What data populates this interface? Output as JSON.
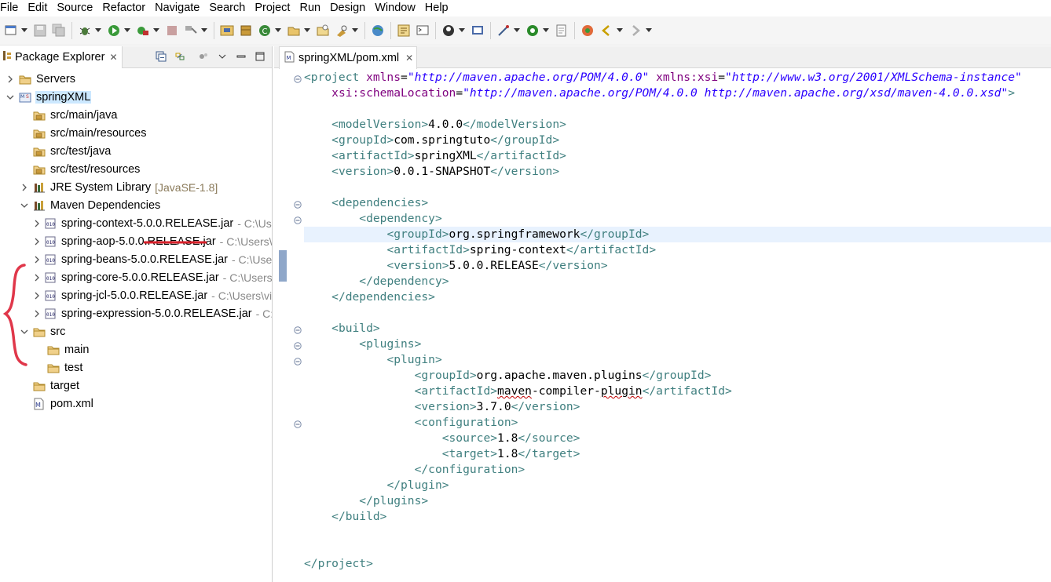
{
  "menu": [
    "File",
    "Edit",
    "Source",
    "Refactor",
    "Navigate",
    "Search",
    "Project",
    "Run",
    "Design",
    "Window",
    "Help"
  ],
  "toolbar": {
    "icons": [
      "new-icon",
      "save-icon",
      "save-all-icon",
      "debug-icon",
      "run-icon",
      "coverage-icon",
      "stop-icon",
      "external-tools-icon",
      "new-java-project-icon",
      "new-package-icon",
      "new-class-icon",
      "open-type-icon",
      "open-task-icon",
      "search-icon",
      "browser-icon",
      "open-perspective-icon",
      "console-icon",
      "pin-icon",
      "spring-icon",
      "annotation-icon",
      "next-annotation-icon",
      "prev-annotation-icon",
      "last-edit-icon",
      "back-icon",
      "forward-icon"
    ]
  },
  "package_explorer": {
    "tab_label": "Package Explorer",
    "tree": [
      {
        "label": "Servers",
        "icon": "folder-icon",
        "indent": 0,
        "expanded": false
      },
      {
        "label": "springXML",
        "icon": "maven-project-icon",
        "indent": 0,
        "expanded": true,
        "selected": true
      },
      {
        "label": "src/main/java",
        "icon": "source-folder-icon",
        "indent": 1
      },
      {
        "label": "src/main/resources",
        "icon": "source-folder-icon",
        "indent": 1
      },
      {
        "label": "src/test/java",
        "icon": "source-folder-icon",
        "indent": 1
      },
      {
        "label": "src/test/resources",
        "icon": "source-folder-icon",
        "indent": 1
      },
      {
        "label": "JRE System Library",
        "decoration": "[JavaSE-1.8]",
        "icon": "library-icon",
        "indent": 1,
        "expanded": false
      },
      {
        "label": "Maven Dependencies",
        "icon": "library-icon",
        "indent": 1,
        "expanded": true
      },
      {
        "label": "spring-context-5.0.0.RELEASE.jar",
        "path": "- C:\\Use",
        "icon": "jar-icon",
        "indent": 2,
        "expanded": false
      },
      {
        "label": "spring-aop-5.0.0.RELEASE.jar",
        "path": "- C:\\Users\\v",
        "icon": "jar-icon",
        "indent": 2,
        "expanded": false
      },
      {
        "label": "spring-beans-5.0.0.RELEASE.jar",
        "path": "- C:\\Users",
        "icon": "jar-icon",
        "indent": 2,
        "expanded": false
      },
      {
        "label": "spring-core-5.0.0.RELEASE.jar",
        "path": "- C:\\Users\\'",
        "icon": "jar-icon",
        "indent": 2,
        "expanded": false
      },
      {
        "label": "spring-jcl-5.0.0.RELEASE.jar",
        "path": "- C:\\Users\\vir",
        "icon": "jar-icon",
        "indent": 2,
        "expanded": false
      },
      {
        "label": "spring-expression-5.0.0.RELEASE.jar",
        "path": "- C:\\",
        "icon": "jar-icon",
        "indent": 2,
        "expanded": false
      },
      {
        "label": "src",
        "icon": "folder-icon",
        "indent": 1,
        "expanded": true
      },
      {
        "label": "main",
        "icon": "folder-icon",
        "indent": 2
      },
      {
        "label": "test",
        "icon": "folder-icon",
        "indent": 2
      },
      {
        "label": "target",
        "icon": "folder-icon",
        "indent": 1
      },
      {
        "label": "pom.xml",
        "icon": "xml-file-icon",
        "indent": 1
      }
    ]
  },
  "editor": {
    "tab_label": "springXML/pom.xml",
    "lines": [
      {
        "indent": "",
        "parts": [
          [
            "tag",
            "<project "
          ],
          [
            "attr",
            "xmlns"
          ],
          [
            "txt",
            "="
          ],
          [
            "val",
            "\"http://maven.apache.org/POM/4.0.0\""
          ],
          [
            "txt",
            " "
          ],
          [
            "attr",
            "xmlns:xsi"
          ],
          [
            "txt",
            "="
          ],
          [
            "val",
            "\"http://www.w3.org/2001/XMLSchema-instance\""
          ]
        ],
        "fold": true
      },
      {
        "indent": "    ",
        "parts": [
          [
            "attr",
            "xsi:schemaLocation"
          ],
          [
            "txt",
            "="
          ],
          [
            "val",
            "\"http://maven.apache.org/POM/4.0.0 http://maven.apache.org/xsd/maven-4.0.0.xsd\""
          ],
          [
            "tag",
            ">"
          ]
        ]
      },
      {
        "indent": "",
        "parts": []
      },
      {
        "indent": "    ",
        "parts": [
          [
            "tag",
            "<modelVersion>"
          ],
          [
            "txt",
            "4.0.0"
          ],
          [
            "tag",
            "</modelVersion>"
          ]
        ]
      },
      {
        "indent": "    ",
        "parts": [
          [
            "tag",
            "<groupId>"
          ],
          [
            "txt",
            "com.springtuto"
          ],
          [
            "tag",
            "</groupId>"
          ]
        ]
      },
      {
        "indent": "    ",
        "parts": [
          [
            "tag",
            "<artifactId>"
          ],
          [
            "txt",
            "springXML"
          ],
          [
            "tag",
            "</artifactId>"
          ]
        ]
      },
      {
        "indent": "    ",
        "parts": [
          [
            "tag",
            "<version>"
          ],
          [
            "txt",
            "0.0.1-SNAPSHOT"
          ],
          [
            "tag",
            "</version>"
          ]
        ]
      },
      {
        "indent": "",
        "parts": []
      },
      {
        "indent": "    ",
        "parts": [
          [
            "tag",
            "<dependencies>"
          ]
        ],
        "fold": true
      },
      {
        "indent": "        ",
        "parts": [
          [
            "tag",
            "<dependency>"
          ]
        ],
        "fold": true
      },
      {
        "indent": "            ",
        "parts": [
          [
            "tag",
            "<groupId>"
          ],
          [
            "txt",
            "org.springframework"
          ],
          [
            "tag",
            "</groupId>"
          ]
        ],
        "current": true
      },
      {
        "indent": "            ",
        "parts": [
          [
            "tag",
            "<artifactId>"
          ],
          [
            "txt",
            "spring-context"
          ],
          [
            "tag",
            "</artifactId>"
          ]
        ]
      },
      {
        "indent": "            ",
        "parts": [
          [
            "tag",
            "<version>"
          ],
          [
            "txt",
            "5.0.0.RELEASE"
          ],
          [
            "tag",
            "</version>"
          ]
        ]
      },
      {
        "indent": "        ",
        "parts": [
          [
            "tag",
            "</dependency>"
          ]
        ]
      },
      {
        "indent": "    ",
        "parts": [
          [
            "tag",
            "</dependencies>"
          ]
        ]
      },
      {
        "indent": "",
        "parts": []
      },
      {
        "indent": "    ",
        "parts": [
          [
            "tag",
            "<build>"
          ]
        ],
        "fold": true
      },
      {
        "indent": "        ",
        "parts": [
          [
            "tag",
            "<plugins>"
          ]
        ],
        "fold": true
      },
      {
        "indent": "            ",
        "parts": [
          [
            "tag",
            "<plugin>"
          ]
        ],
        "fold": true
      },
      {
        "indent": "                ",
        "parts": [
          [
            "tag",
            "<groupId>"
          ],
          [
            "txt",
            "org.apache.maven.plugins"
          ],
          [
            "tag",
            "</groupId>"
          ]
        ]
      },
      {
        "indent": "                ",
        "parts": [
          [
            "tag",
            "<artifactId>"
          ],
          [
            "squig",
            "maven"
          ],
          [
            "txt",
            "-compiler-"
          ],
          [
            "squig",
            "plugin"
          ],
          [
            "tag",
            "</artifactId>"
          ]
        ]
      },
      {
        "indent": "                ",
        "parts": [
          [
            "tag",
            "<version>"
          ],
          [
            "txt",
            "3.7.0"
          ],
          [
            "tag",
            "</version>"
          ]
        ]
      },
      {
        "indent": "                ",
        "parts": [
          [
            "tag",
            "<configuration>"
          ]
        ],
        "fold": true
      },
      {
        "indent": "                    ",
        "parts": [
          [
            "tag",
            "<source>"
          ],
          [
            "txt",
            "1.8"
          ],
          [
            "tag",
            "</source>"
          ]
        ]
      },
      {
        "indent": "                    ",
        "parts": [
          [
            "tag",
            "<target>"
          ],
          [
            "txt",
            "1.8"
          ],
          [
            "tag",
            "</target>"
          ]
        ]
      },
      {
        "indent": "                ",
        "parts": [
          [
            "tag",
            "</configuration>"
          ]
        ]
      },
      {
        "indent": "            ",
        "parts": [
          [
            "tag",
            "</plugin>"
          ]
        ]
      },
      {
        "indent": "        ",
        "parts": [
          [
            "tag",
            "</plugins>"
          ]
        ]
      },
      {
        "indent": "    ",
        "parts": [
          [
            "tag",
            "</build>"
          ]
        ]
      },
      {
        "indent": "",
        "parts": []
      },
      {
        "indent": "",
        "parts": []
      },
      {
        "indent": "",
        "parts": [
          [
            "tag",
            "</project>"
          ]
        ]
      }
    ]
  },
  "colors": {
    "selection": "#cce8ff",
    "current_line": "#e8f2fe",
    "tag": "#3f7f7f",
    "attribute": "#7f007f",
    "value": "#2a00ff",
    "annotation": "#e0374a"
  }
}
